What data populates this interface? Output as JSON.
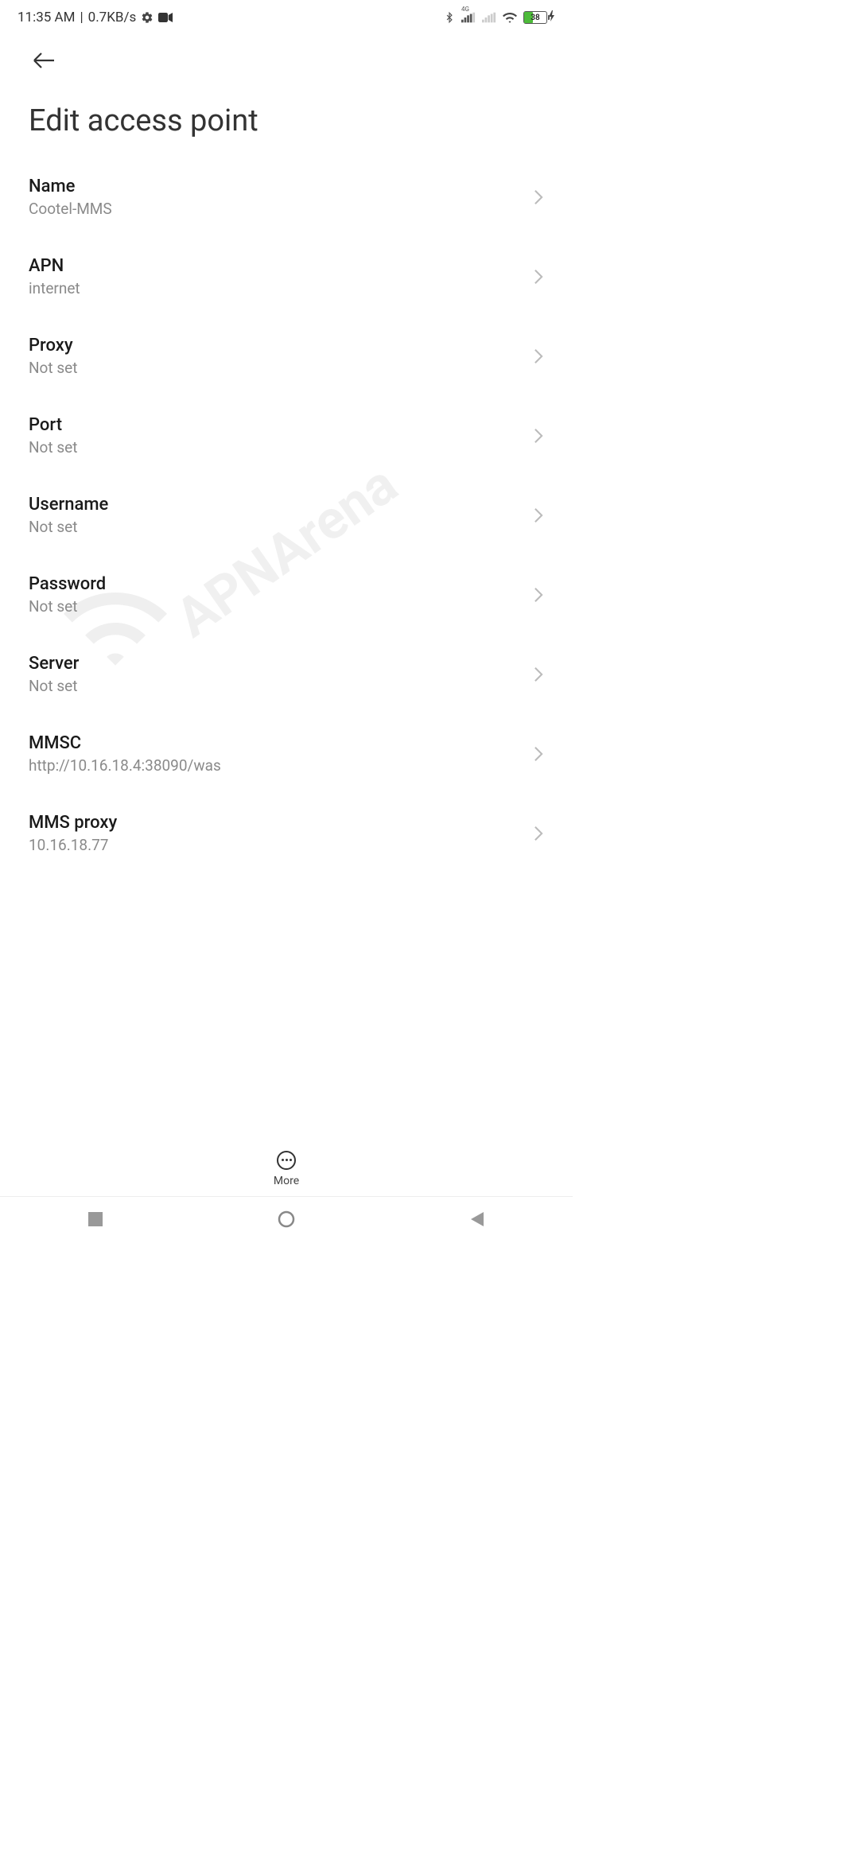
{
  "status": {
    "time": "11:35 AM",
    "sep": "|",
    "net_speed": "0.7KB/s",
    "battery": "38",
    "signal_tag": "4G"
  },
  "header": {
    "title": "Edit access point"
  },
  "rows": [
    {
      "label": "Name",
      "value": "Cootel-MMS"
    },
    {
      "label": "APN",
      "value": "internet"
    },
    {
      "label": "Proxy",
      "value": "Not set"
    },
    {
      "label": "Port",
      "value": "Not set"
    },
    {
      "label": "Username",
      "value": "Not set"
    },
    {
      "label": "Password",
      "value": "Not set"
    },
    {
      "label": "Server",
      "value": "Not set"
    },
    {
      "label": "MMSC",
      "value": "http://10.16.18.4:38090/was"
    },
    {
      "label": "MMS proxy",
      "value": "10.16.18.77"
    }
  ],
  "bottom": {
    "more_label": "More"
  },
  "watermark": "APNArena"
}
